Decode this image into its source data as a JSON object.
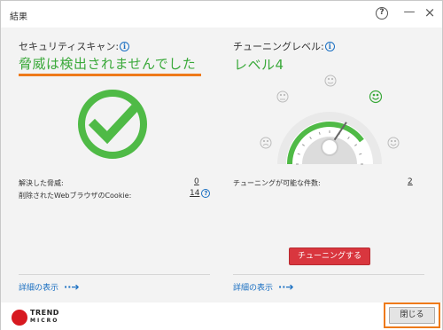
{
  "window": {
    "title": "結果"
  },
  "controls": {
    "help": "?",
    "minimize": "—",
    "close": "×"
  },
  "security": {
    "title": "セキュリティスキャン:",
    "result": "脅威は検出されませんでした",
    "rows": [
      {
        "label": "解決した脅威:",
        "value": "0"
      },
      {
        "label": "削除されたWebブラウザのCookie:",
        "value": "14"
      }
    ],
    "detail_link": "詳細の表示"
  },
  "tuning": {
    "title": "チューニングレベル:",
    "level": "レベル4",
    "gauge_level": 4,
    "gauge_max": 5,
    "rows": [
      {
        "label": "チューニングが可能な件数:",
        "value": "2"
      }
    ],
    "tune_button": "チューニングする",
    "detail_link": "詳細の表示"
  },
  "footer": {
    "logo_line1": "TREND",
    "logo_line2": "MICRO",
    "close_button": "閉じる"
  },
  "colors": {
    "success_green": "#3aa93a",
    "highlight_orange": "#ee7a1a",
    "link_blue": "#1a6fc2",
    "tune_red": "#d9363e"
  }
}
